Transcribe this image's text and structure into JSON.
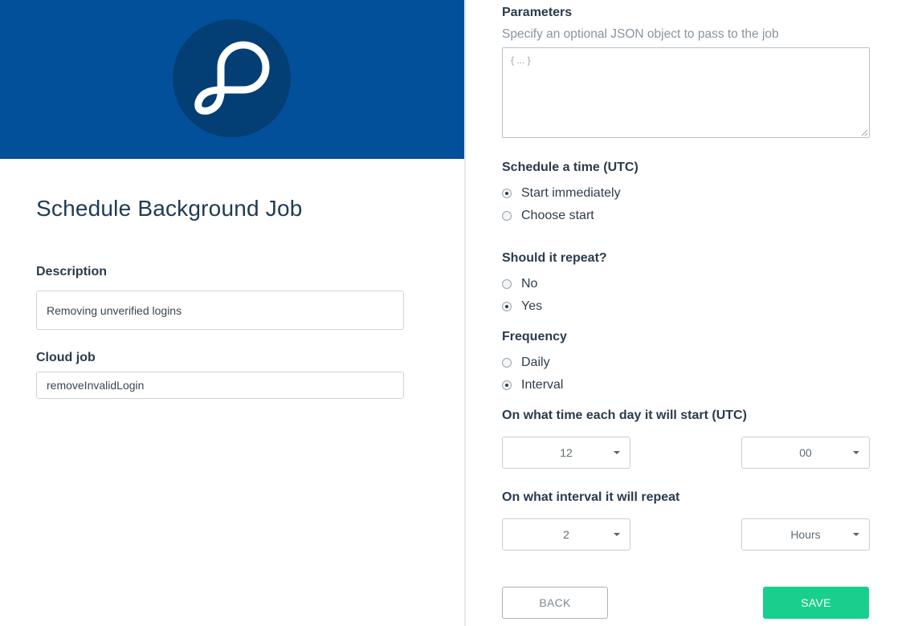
{
  "colors": {
    "hero_bg": "#02509a",
    "logo_bg": "#033e74",
    "accent_green": "#19cf8d",
    "title_text": "#1f3b55"
  },
  "left": {
    "logo_icon": "parse-logo-icon",
    "title": "Schedule Background Job",
    "description": {
      "label": "Description",
      "value": "Removing unverified logins"
    },
    "cloud_job": {
      "label": "Cloud job",
      "value": "removeInvalidLogin"
    }
  },
  "right": {
    "parameters": {
      "label": "Parameters",
      "hint": "Specify an optional JSON object to pass to the job",
      "placeholder": "{ ... }"
    },
    "schedule": {
      "label": "Schedule a time (UTC)",
      "options": [
        {
          "label": "Start immediately",
          "checked": true
        },
        {
          "label": "Choose start",
          "checked": false
        }
      ]
    },
    "repeat": {
      "label": "Should it repeat?",
      "options": [
        {
          "label": "No",
          "checked": false
        },
        {
          "label": "Yes",
          "checked": true
        }
      ]
    },
    "frequency": {
      "label": "Frequency",
      "options": [
        {
          "label": "Daily",
          "checked": false
        },
        {
          "label": "Interval",
          "checked": true
        }
      ]
    },
    "start_time": {
      "label": "On what time each day it will start (UTC)",
      "hour": "12",
      "minute": "00"
    },
    "interval": {
      "label": "On what interval it will repeat",
      "value": "2",
      "unit": "Hours"
    },
    "buttons": {
      "back": "BACK",
      "save": "SAVE"
    }
  }
}
